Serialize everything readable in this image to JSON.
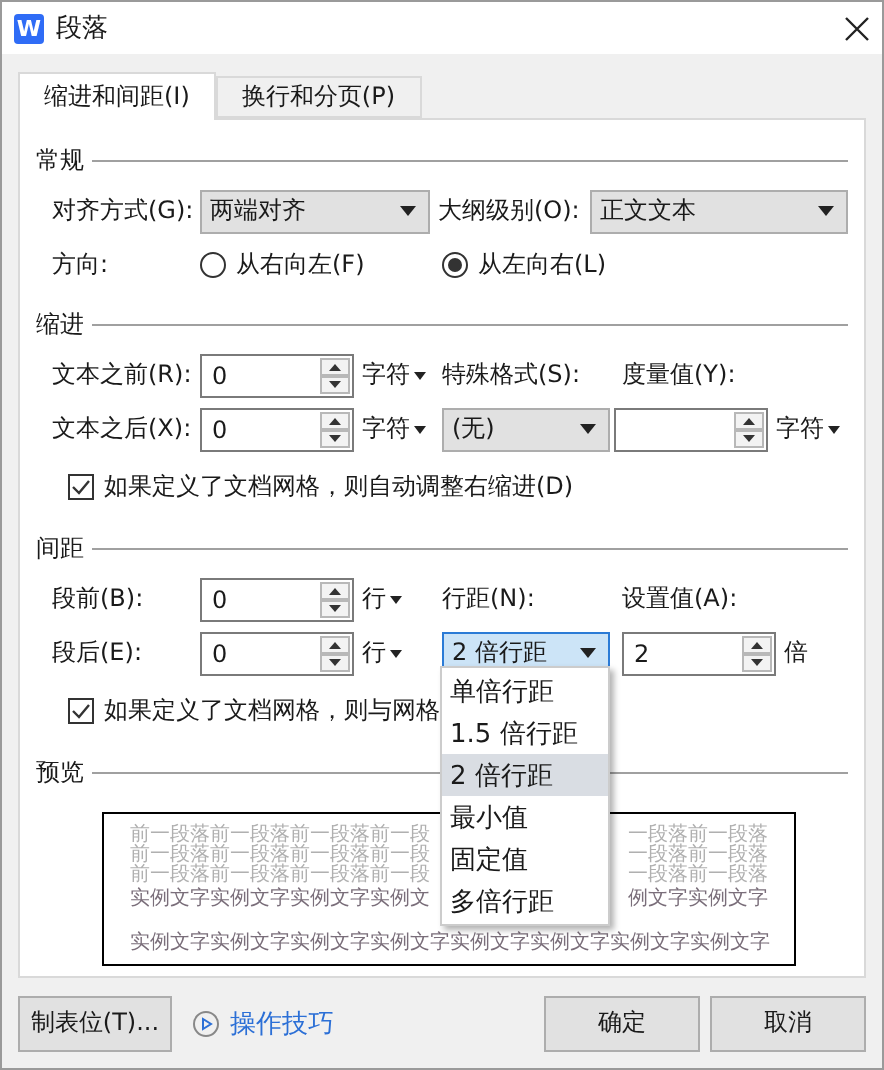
{
  "window": {
    "title": "段落",
    "app_icon": "W"
  },
  "tabs": [
    {
      "label": "缩进和间距(I)",
      "selected": true
    },
    {
      "label": "换行和分页(P)",
      "selected": false
    }
  ],
  "general": {
    "heading": "常规",
    "alignment": {
      "label": "对齐方式(G):",
      "value": "两端对齐"
    },
    "outline_level": {
      "label": "大纲级别(O):",
      "value": "正文文本"
    },
    "direction": {
      "label": "方向:",
      "options": [
        {
          "label": "从右向左(F)",
          "selected": false
        },
        {
          "label": "从左向右(L)",
          "selected": true
        }
      ]
    }
  },
  "indent": {
    "heading": "缩进",
    "before_text": {
      "label": "文本之前(R):",
      "value": "0",
      "unit": "字符"
    },
    "after_text": {
      "label": "文本之后(X):",
      "value": "0",
      "unit": "字符"
    },
    "special": {
      "label": "特殊格式(S):",
      "value": "(无)"
    },
    "measure": {
      "label": "度量值(Y):",
      "unit": "字符"
    },
    "grid_checkbox": {
      "label": "如果定义了文档网格，则自动调整右缩进(D)",
      "checked": true
    }
  },
  "spacing": {
    "heading": "间距",
    "before": {
      "label": "段前(B):",
      "value": "0",
      "unit": "行"
    },
    "after": {
      "label": "段后(E):",
      "value": "0",
      "unit": "行"
    },
    "line_spacing": {
      "label": "行距(N):",
      "value": "2 倍行距"
    },
    "setting": {
      "label": "设置值(A):",
      "value": "2",
      "unit": "倍"
    },
    "grid_checkbox": {
      "label": "如果定义了文档网格，则与网格",
      "checked": true
    }
  },
  "line_spacing_menu": [
    {
      "label": "单倍行距",
      "selected": false
    },
    {
      "label": "1.5 倍行距",
      "selected": false
    },
    {
      "label": "2 倍行距",
      "selected": true
    },
    {
      "label": "最小值",
      "selected": false
    },
    {
      "label": "固定值",
      "selected": false
    },
    {
      "label": "多倍行距",
      "selected": false
    }
  ],
  "preview": {
    "heading": "预览",
    "previous_lines": [
      {
        "left": "前一段落前一段落前一段落前一段",
        "right": "一段落前一段落"
      },
      {
        "left": "前一段落前一段落前一段落前一段",
        "right": "一段落前一段落"
      },
      {
        "left": "前一段落前一段落前一段落前一段",
        "right": "一段落前一段落"
      }
    ],
    "sample_lines": [
      {
        "left": "实例文字实例文字实例文字实例文",
        "right": "例文字实例文字"
      }
    ],
    "last_sample_line": "实例文字实例文字实例文字实例文字实例文字实例文字实例文字实例文字"
  },
  "footer": {
    "tab_stops": "制表位(T)...",
    "tips": "操作技巧",
    "ok": "确定",
    "cancel": "取消"
  }
}
